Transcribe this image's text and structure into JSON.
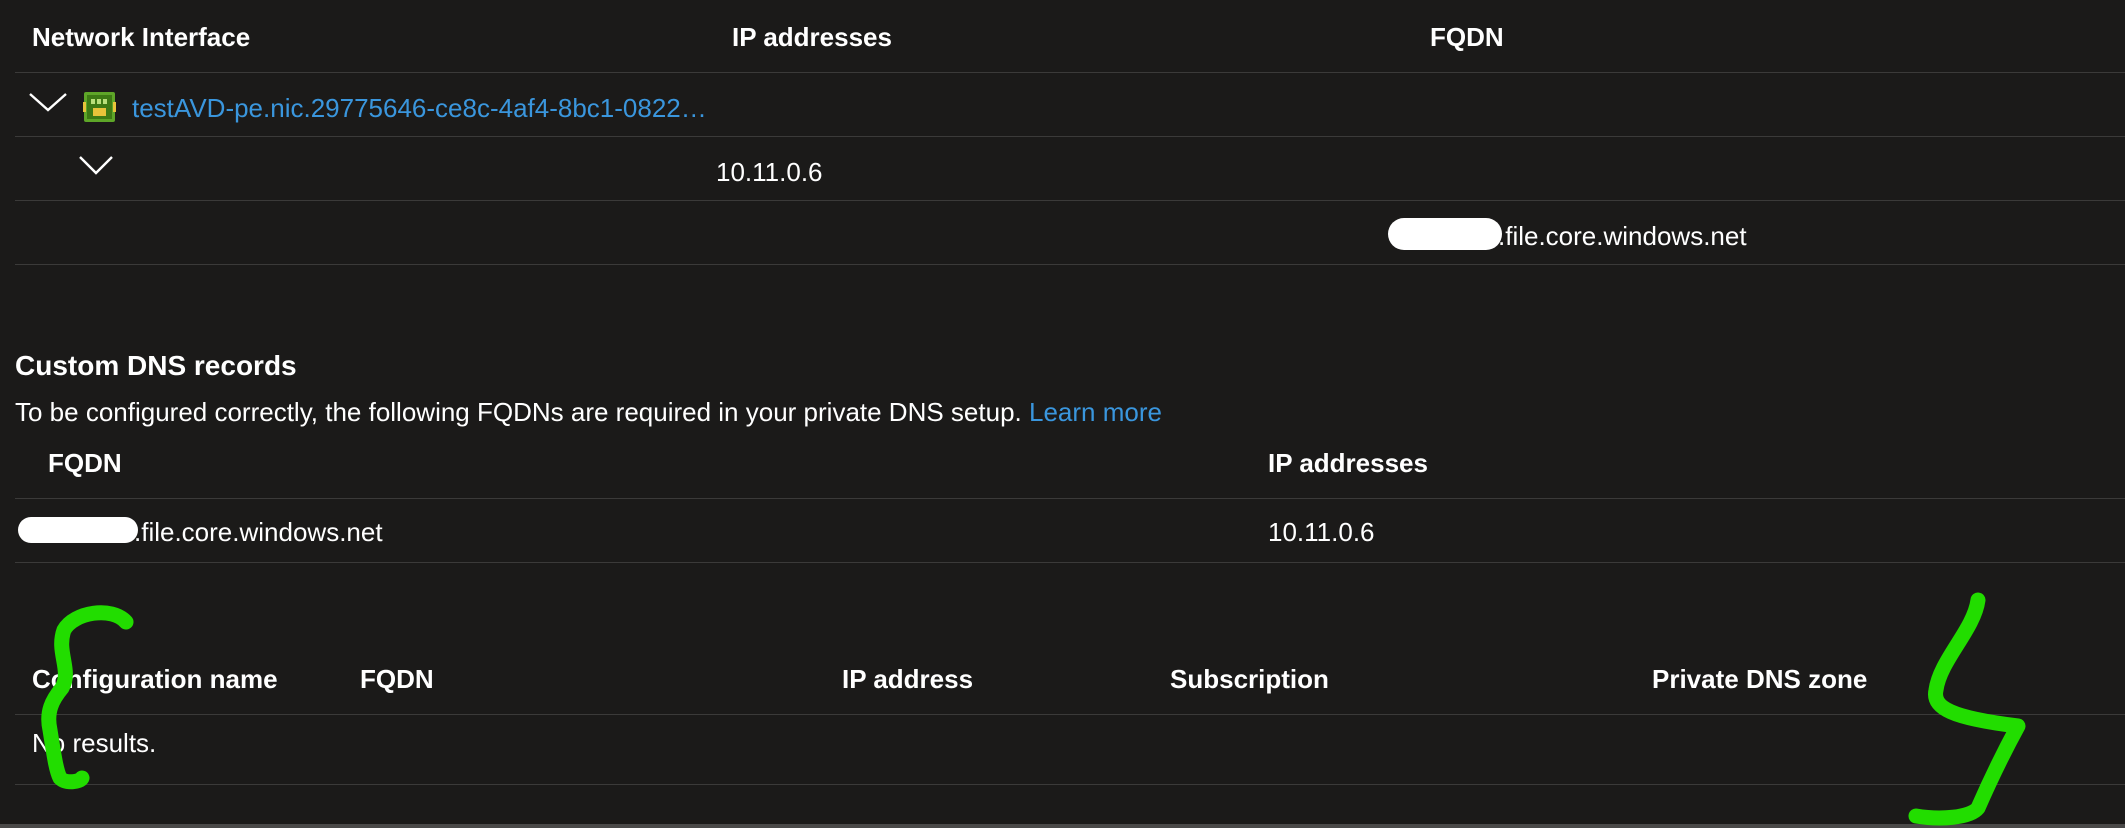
{
  "nic_table": {
    "headers": {
      "network_interface": "Network Interface",
      "ip_addresses": "IP addresses",
      "fqdn": "FQDN"
    },
    "nic_name": "testAVD-pe.nic.29775646-ce8c-4af4-8bc1-0822…",
    "ip_address": "10.11.0.6",
    "fqdn_suffix": ".file.core.windows.net"
  },
  "custom_dns": {
    "title": "Custom DNS records",
    "description": "To be configured correctly, the following FQDNs are required in your private DNS setup.",
    "learn_more": "Learn more",
    "headers": {
      "fqdn": "FQDN",
      "ip_addresses": "IP addresses"
    },
    "row": {
      "fqdn_suffix": ".file.core.windows.net",
      "ip": "10.11.0.6"
    }
  },
  "config_table": {
    "headers": {
      "configuration_name": "Configuration name",
      "fqdn": "FQDN",
      "ip_address": "IP address",
      "subscription": "Subscription",
      "private_dns_zone": "Private DNS zone"
    },
    "empty_text": "No results."
  },
  "colors": {
    "background": "#1b1a19",
    "link": "#3a96dd",
    "divider": "#3b3a39",
    "annotation": "#22dd00"
  },
  "icons": [
    "chevron-down-icon",
    "network-interface-icon"
  ]
}
